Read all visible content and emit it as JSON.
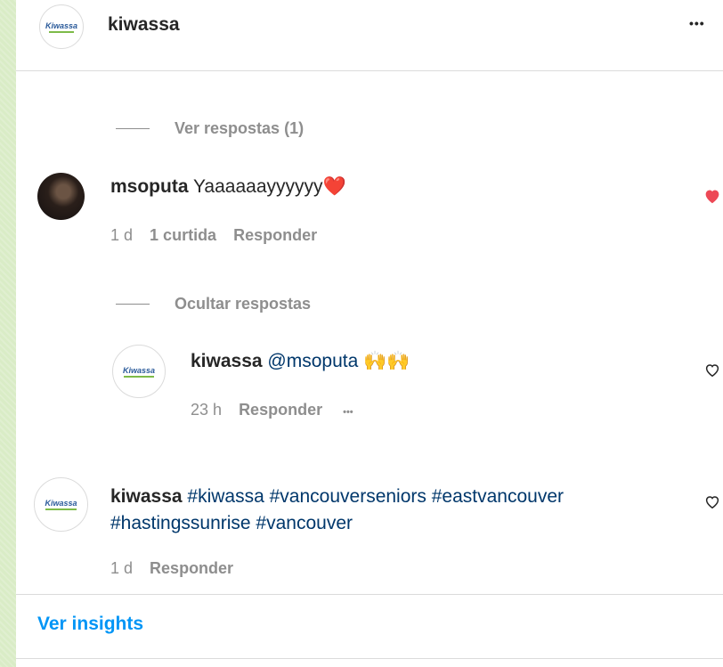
{
  "header": {
    "avatar_logo_text": "Kiwassa",
    "username": "kiwassa",
    "more_glyph": "•••"
  },
  "thread1": {
    "toggle_label": "Ver respostas (1)"
  },
  "comment1": {
    "username": "msoputa",
    "text": "Yaaaaaayyyyyy",
    "emoji": "❤️",
    "time": "1 d",
    "likes": "1 curtida",
    "reply": "Responder",
    "liked": true
  },
  "thread2": {
    "toggle_label": "Ocultar respostas"
  },
  "reply1": {
    "avatar_logo_text": "Kiwassa",
    "username": "kiwassa",
    "mention": "@msoputa",
    "emoji": "🙌🙌",
    "time": "23 h",
    "reply": "Responder",
    "more_glyph": "•••"
  },
  "comment2": {
    "avatar_logo_text": "Kiwassa",
    "username": "kiwassa",
    "hashtags_line1": "#kiwassa #vancouverseniors #eastvancouver",
    "hashtags_line2": "#hastingssunrise #vancouver",
    "time": "1 d",
    "reply": "Responder"
  },
  "footer": {
    "insights_label": "Ver insights"
  },
  "colors": {
    "background": "#d9ecc6",
    "link": "#00376b",
    "accent": "#0095f6",
    "heart": "#ed4956",
    "muted": "#8e8e8e"
  }
}
